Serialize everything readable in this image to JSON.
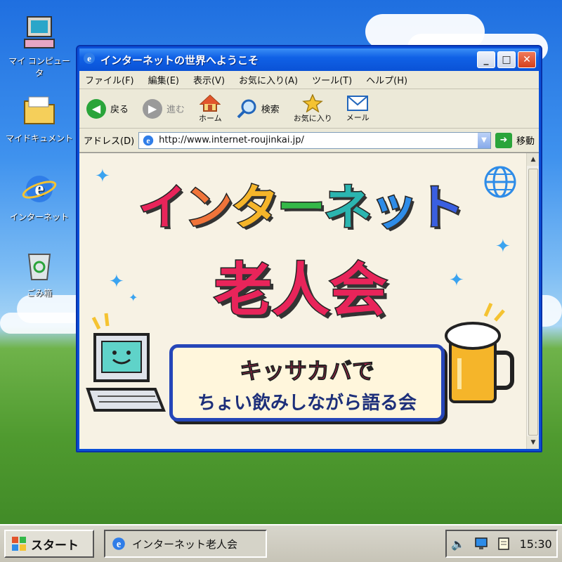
{
  "desktop": {
    "icons": [
      {
        "label": "マイ コンピュータ"
      },
      {
        "label": "マイドキュメント"
      },
      {
        "label": "インターネット"
      },
      {
        "label": "ごみ箱"
      }
    ]
  },
  "window": {
    "title": "インターネットの世界へようこそ",
    "menu": [
      "ファイル(F)",
      "編集(E)",
      "表示(V)",
      "お気に入り(A)",
      "ツール(T)",
      "ヘルプ(H)"
    ],
    "toolbar": {
      "back": "戻る",
      "forward": "進む",
      "home": "ホーム",
      "search": "検索",
      "favorites": "お気に入り",
      "mail": "メール"
    },
    "address": {
      "label": "アドレス(D)",
      "url": "http://www.internet-roujinkai.jp/",
      "go": "移動"
    }
  },
  "page": {
    "headline_chars": [
      "イ",
      "ン",
      "タ",
      "ー",
      "ネ",
      "ッ",
      "ト"
    ],
    "headline_colors": [
      "#e8245a",
      "#f0743a",
      "#f5b52a",
      "#34b848",
      "#2bb5b0",
      "#2e8ce8",
      "#3a5fe0"
    ],
    "sub_headline": "老人会",
    "banner_line1": "キッサカバで",
    "banner_line2": "ちょい飲みしながら語る会"
  },
  "taskbar": {
    "start": "スタート",
    "task": "インターネット老人会",
    "clock": "15:30"
  },
  "colors": {
    "accent": "#0a52d6",
    "headline_sub": "#e8245a",
    "banner_border": "#2546b8"
  }
}
